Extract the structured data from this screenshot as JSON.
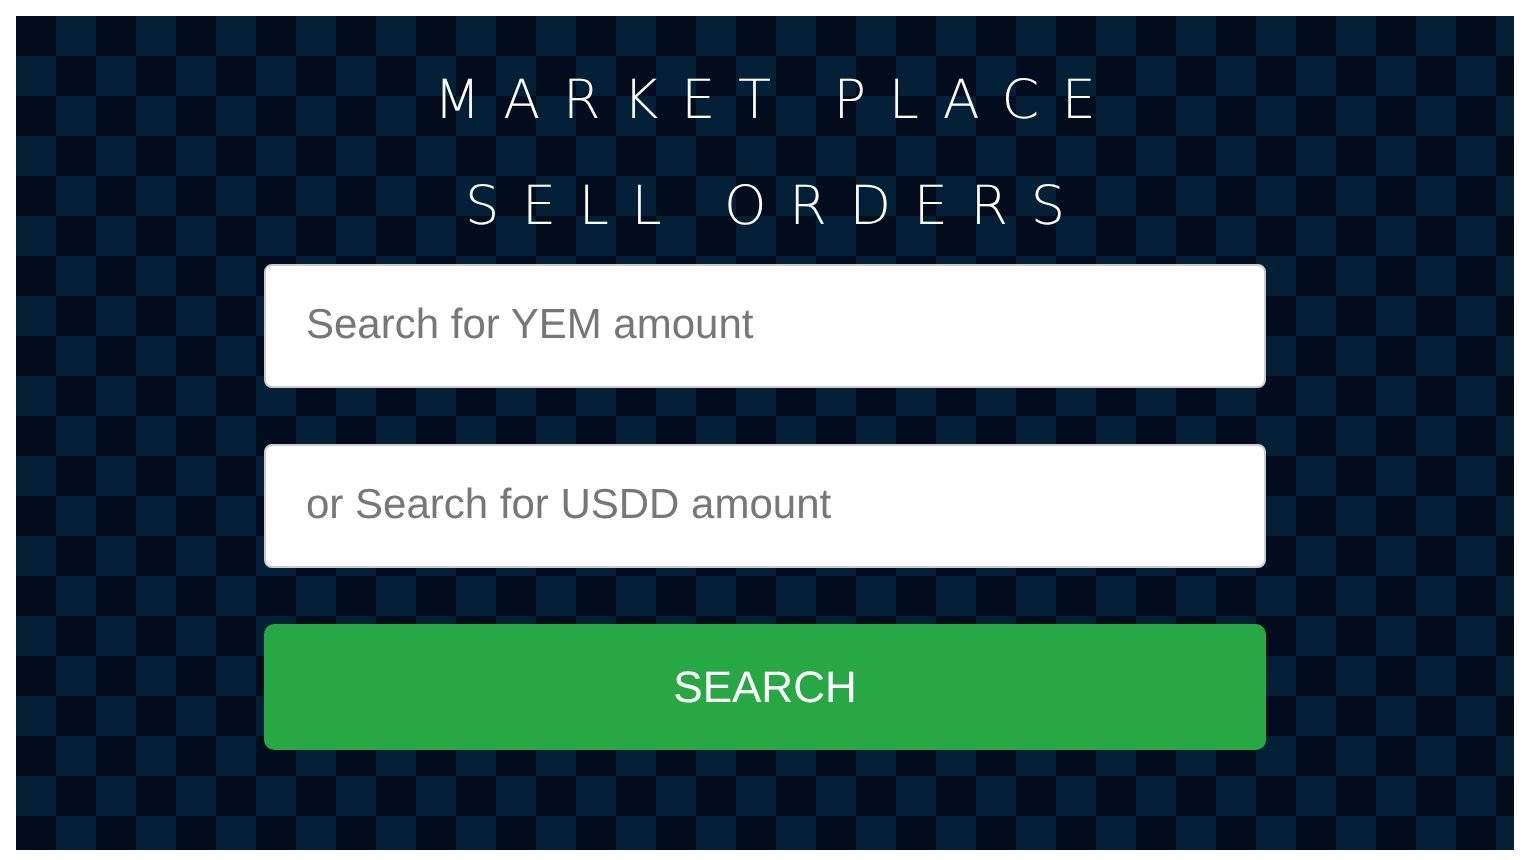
{
  "title_lines": [
    "MARKET PLACE",
    "SELL ORDERS"
  ],
  "fields": [
    {
      "placeholder": "Search for YEM amount"
    },
    {
      "placeholder": "or Search for USDD amount"
    }
  ],
  "button": {
    "label": "SEARCH"
  }
}
